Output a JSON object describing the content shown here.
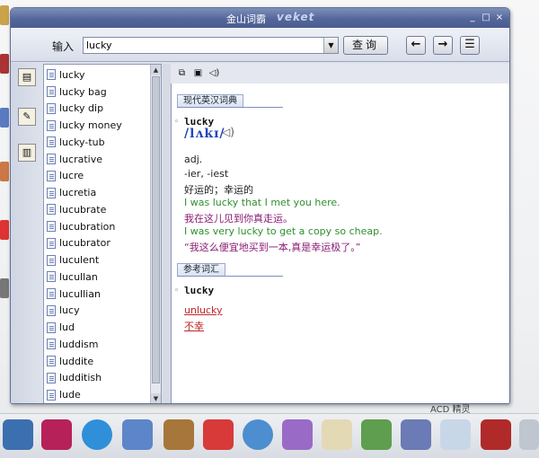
{
  "window": {
    "title": "金山词霸",
    "brand": "veket",
    "controls": [
      "_",
      "□",
      "×"
    ]
  },
  "toolbar": {
    "input_label": "输入",
    "search_value": "lucky",
    "query_label": "查询",
    "back_icon": "left-arrow-icon",
    "forward_icon": "right-arrow-icon",
    "menu_icon": "list-icon"
  },
  "word_list": [
    "lucky",
    "lucky bag",
    "lucky dip",
    "lucky money",
    "lucky-tub",
    "lucrative",
    "lucre",
    "lucretia",
    "lucubrate",
    "lucubration",
    "lucubrator",
    "luculent",
    "lucullan",
    "lucullian",
    "lucy",
    "lud",
    "luddism",
    "luddite",
    "ludditish",
    "lude"
  ],
  "definition": {
    "section1": "现代英汉词典",
    "headword": "lucky",
    "phonetic": "/lʌkɪ/",
    "lines": [
      {
        "text": "adj.",
        "color": "black"
      },
      {
        "text": "-ier, -iest",
        "color": "black"
      },
      {
        "text": "好运的；幸运的",
        "color": "black"
      },
      {
        "text": "I was lucky that I met you here.",
        "color": "green"
      },
      {
        "text": "我在这儿见到你真走运。",
        "color": "purple"
      },
      {
        "text": "I was very lucky to get a copy so cheap.",
        "color": "green"
      },
      {
        "text": "“我这么便宜地买到一本,真是幸运极了。”",
        "color": "purple"
      }
    ],
    "section2": "参考词汇",
    "ref_headword": "lucky",
    "ref_link1": "unlucky",
    "ref_link2": "不幸"
  },
  "desktop": {
    "right_label": "ACD 精灵"
  },
  "colors": {
    "titlebar": "#54679b",
    "green_example": "#2f8f2f",
    "purple_translation": "#8a1b74",
    "link": "#c0262a"
  }
}
